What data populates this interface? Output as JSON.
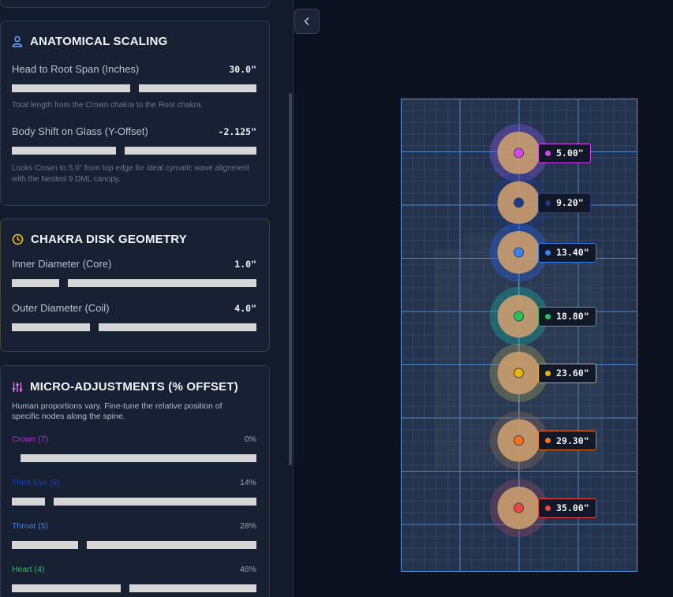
{
  "anatomical": {
    "title": "ANATOMICAL SCALING",
    "span_label": "Head to Root Span (Inches)",
    "span_value": "30.0\"",
    "span_fraction": 0.5,
    "span_help": "Total length from the Crown chakra to the Root chakra.",
    "shift_label": "Body Shift on Glass (Y-Offset)",
    "shift_value": "-2.125\"",
    "shift_fraction": 0.44,
    "shift_help": "Locks Crown to 5.0\" from top edge for ideal cymatic wave alignment with the Nested 9 DML canopy."
  },
  "geometry": {
    "title": "CHAKRA DISK GEOMETRY",
    "inner_label": "Inner Diameter (Core)",
    "inner_value": "1.0\"",
    "inner_fraction": 0.2,
    "outer_label": "Outer Diameter (Coil)",
    "outer_value": "4.0\"",
    "outer_fraction": 0.33
  },
  "micro": {
    "title": "MICRO-ADJUSTMENTS (% OFFSET)",
    "description": "Human proportions vary. Fine-tune the relative position of specific nodes along the spine.",
    "nodes": [
      {
        "label": "Crown (7)",
        "pct": "0%",
        "fraction": 0.0,
        "color": "#c026d3"
      },
      {
        "label": "Third Eye (6)",
        "pct": "14%",
        "fraction": 0.14,
        "color": "#1e40af"
      },
      {
        "label": "Throat (5)",
        "pct": "28%",
        "fraction": 0.28,
        "color": "#3b82f6"
      },
      {
        "label": "Heart (4)",
        "pct": "46%",
        "fraction": 0.46,
        "color": "#22c55e"
      }
    ]
  },
  "markers": [
    {
      "label": "5.00\"",
      "inches": 5.0,
      "color": "#d946ef",
      "ring": "#8b5cf6"
    },
    {
      "label": "9.20\"",
      "inches": 9.2,
      "color": "#1e3a8a",
      "ring": "#1e3a8a"
    },
    {
      "label": "13.40\"",
      "inches": 13.4,
      "color": "#3b82f6",
      "ring": "#2563eb"
    },
    {
      "label": "18.80\"",
      "inches": 18.8,
      "color": "#22c55e",
      "ring": "#14b8a6"
    },
    {
      "label": "23.60\"",
      "inches": 23.6,
      "color": "#eab308",
      "ring": "#a3a35c"
    },
    {
      "label": "29.30\"",
      "inches": 29.3,
      "color": "#f97316",
      "ring": "#8a6a5a"
    },
    {
      "label": "35.00\"",
      "inches": 35.0,
      "color": "#ef4444",
      "ring": "#9a4a6a"
    }
  ],
  "glass_height_inches": 40
}
